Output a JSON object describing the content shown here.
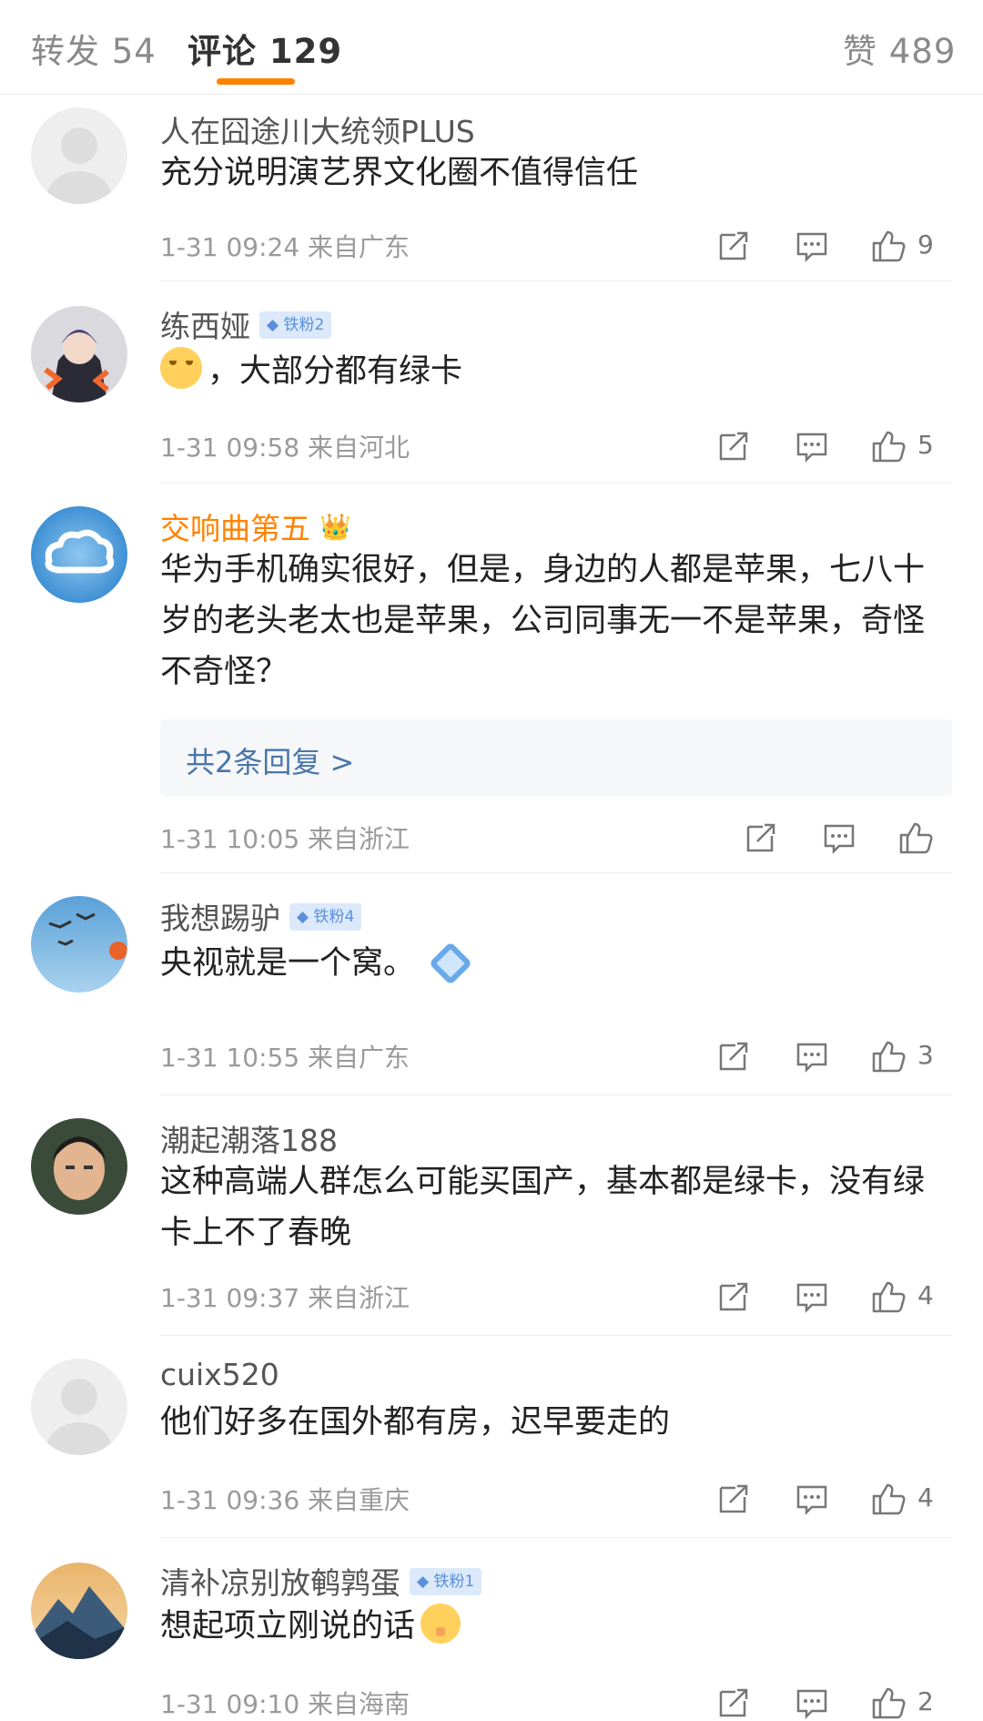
{
  "tabs": {
    "repost": "转发 54",
    "comment": "评论 129",
    "like": "赞 489"
  },
  "comments": [
    {
      "name": "人在囧途川大统领PLUS",
      "text": "充分说明演艺界文化圈不值得信任",
      "time": "1-31 09:24",
      "location": "来自广东",
      "likes": "9"
    },
    {
      "name": "练西娅",
      "badge": "铁粉2",
      "text": "，大部分都有绿卡",
      "time": "1-31 09:58",
      "location": "来自河北",
      "likes": "5"
    },
    {
      "name": "交响曲第五",
      "text": "华为手机确实很好，但是，身边的人都是苹果，七八十岁的老头老太也是苹果，公司同事无一不是苹果，奇怪不奇怪？",
      "replies": "共2条回复 >",
      "time": "1-31 10:05",
      "location": "来自浙江",
      "likes": ""
    },
    {
      "name": "我想踢驴",
      "badge": "铁粉4",
      "text": "央视就是一个窝。",
      "time": "1-31 10:55",
      "location": "来自广东",
      "likes": "3"
    },
    {
      "name": "潮起潮落188",
      "text": "这种高端人群怎么可能买国产，基本都是绿卡，没有绿卡上不了春晚",
      "time": "1-31 09:37",
      "location": "来自浙江",
      "likes": "4"
    },
    {
      "name": "cuix520",
      "text": "他们好多在国外都有房，迟早要走的",
      "time": "1-31 09:36",
      "location": "来自重庆",
      "likes": "4"
    },
    {
      "name": "清补凉别放鹌鹑蛋",
      "badge": "铁粉1",
      "text": "想起项立刚说的话",
      "time": "1-31 09:10",
      "location": "来自海南",
      "likes": "2"
    }
  ],
  "icons": {
    "repost": "repost-icon",
    "reply": "comment-icon",
    "like": "thumbs-up-icon"
  },
  "colors": {
    "accent": "#ff8200",
    "link": "#4a76a8",
    "badge_bg": "#dbe9fb"
  }
}
